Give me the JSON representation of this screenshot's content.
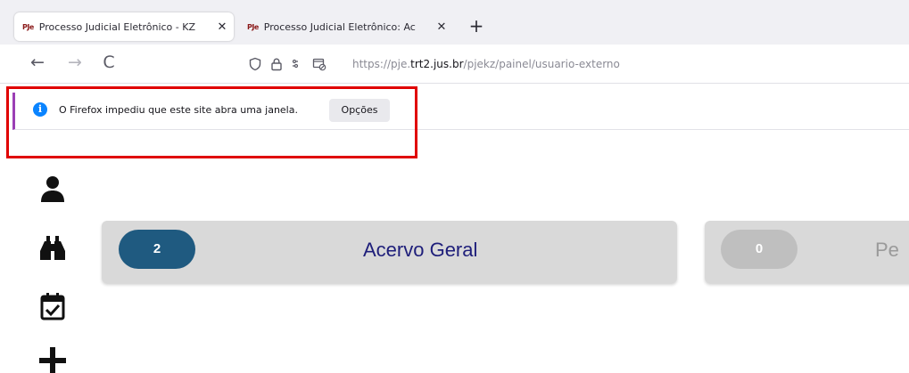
{
  "browser": {
    "tabs": [
      {
        "favicon": "PJe",
        "title": "Processo Judicial Eletrônico - KZ",
        "close_glyph": "✕",
        "active": true
      },
      {
        "favicon": "PJe",
        "title": "Processo Judicial Eletrônico: Ac",
        "close_glyph": "✕",
        "active": false
      }
    ],
    "new_tab_glyph": "+",
    "nav": {
      "back_glyph": "←",
      "forward_glyph": "→",
      "reload_glyph": "C"
    },
    "url": {
      "prefix": "https://pje.",
      "domain": "trt2.jus.br",
      "path": "/pjekz/painel/usuario-externo"
    }
  },
  "notification": {
    "icon": "info-icon",
    "message": "O Firefox impediu que este site abra uma janela.",
    "options_label": "Opções",
    "accent_color": "#9b3fb5"
  },
  "highlight_color": "#e00000",
  "sidebar": {
    "icons": [
      "user-icon",
      "binoculars-icon",
      "calendar-check-icon",
      "plus-icon"
    ]
  },
  "cards": [
    {
      "count": "2",
      "label": "Acervo Geral",
      "pill_color": "#1f5a80",
      "label_color": "#1e1e7a"
    },
    {
      "count": "0",
      "label": "Pe",
      "pill_color": "#bfbfbf",
      "label_color": "#9a9a9a"
    }
  ]
}
